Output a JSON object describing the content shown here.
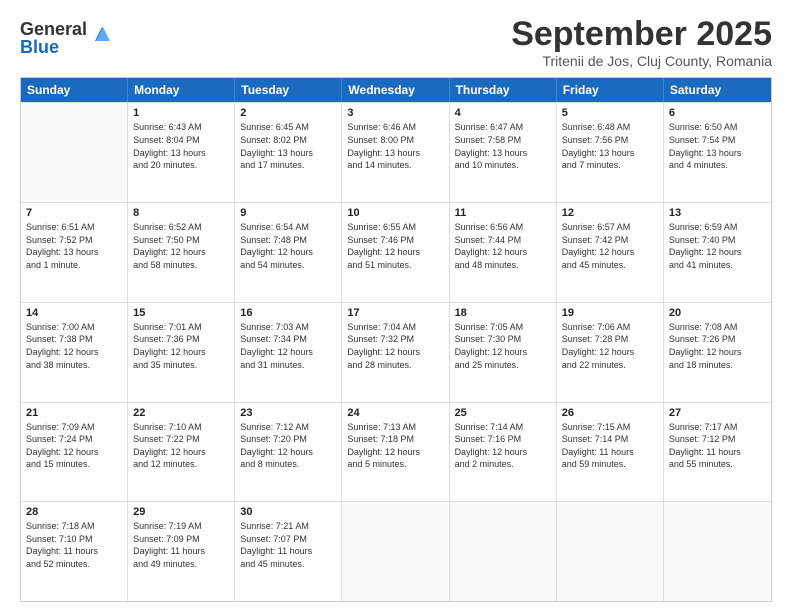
{
  "logo": {
    "general": "General",
    "blue": "Blue"
  },
  "title": "September 2025",
  "subtitle": "Tritenii de Jos, Cluj County, Romania",
  "header_days": [
    "Sunday",
    "Monday",
    "Tuesday",
    "Wednesday",
    "Thursday",
    "Friday",
    "Saturday"
  ],
  "weeks": [
    [
      {
        "day": "",
        "empty": true,
        "lines": []
      },
      {
        "day": "1",
        "empty": false,
        "lines": [
          "Sunrise: 6:43 AM",
          "Sunset: 8:04 PM",
          "Daylight: 13 hours",
          "and 20 minutes."
        ]
      },
      {
        "day": "2",
        "empty": false,
        "lines": [
          "Sunrise: 6:45 AM",
          "Sunset: 8:02 PM",
          "Daylight: 13 hours",
          "and 17 minutes."
        ]
      },
      {
        "day": "3",
        "empty": false,
        "lines": [
          "Sunrise: 6:46 AM",
          "Sunset: 8:00 PM",
          "Daylight: 13 hours",
          "and 14 minutes."
        ]
      },
      {
        "day": "4",
        "empty": false,
        "lines": [
          "Sunrise: 6:47 AM",
          "Sunset: 7:58 PM",
          "Daylight: 13 hours",
          "and 10 minutes."
        ]
      },
      {
        "day": "5",
        "empty": false,
        "lines": [
          "Sunrise: 6:48 AM",
          "Sunset: 7:56 PM",
          "Daylight: 13 hours",
          "and 7 minutes."
        ]
      },
      {
        "day": "6",
        "empty": false,
        "lines": [
          "Sunrise: 6:50 AM",
          "Sunset: 7:54 PM",
          "Daylight: 13 hours",
          "and 4 minutes."
        ]
      }
    ],
    [
      {
        "day": "7",
        "empty": false,
        "lines": [
          "Sunrise: 6:51 AM",
          "Sunset: 7:52 PM",
          "Daylight: 13 hours",
          "and 1 minute."
        ]
      },
      {
        "day": "8",
        "empty": false,
        "lines": [
          "Sunrise: 6:52 AM",
          "Sunset: 7:50 PM",
          "Daylight: 12 hours",
          "and 58 minutes."
        ]
      },
      {
        "day": "9",
        "empty": false,
        "lines": [
          "Sunrise: 6:54 AM",
          "Sunset: 7:48 PM",
          "Daylight: 12 hours",
          "and 54 minutes."
        ]
      },
      {
        "day": "10",
        "empty": false,
        "lines": [
          "Sunrise: 6:55 AM",
          "Sunset: 7:46 PM",
          "Daylight: 12 hours",
          "and 51 minutes."
        ]
      },
      {
        "day": "11",
        "empty": false,
        "lines": [
          "Sunrise: 6:56 AM",
          "Sunset: 7:44 PM",
          "Daylight: 12 hours",
          "and 48 minutes."
        ]
      },
      {
        "day": "12",
        "empty": false,
        "lines": [
          "Sunrise: 6:57 AM",
          "Sunset: 7:42 PM",
          "Daylight: 12 hours",
          "and 45 minutes."
        ]
      },
      {
        "day": "13",
        "empty": false,
        "lines": [
          "Sunrise: 6:59 AM",
          "Sunset: 7:40 PM",
          "Daylight: 12 hours",
          "and 41 minutes."
        ]
      }
    ],
    [
      {
        "day": "14",
        "empty": false,
        "lines": [
          "Sunrise: 7:00 AM",
          "Sunset: 7:38 PM",
          "Daylight: 12 hours",
          "and 38 minutes."
        ]
      },
      {
        "day": "15",
        "empty": false,
        "lines": [
          "Sunrise: 7:01 AM",
          "Sunset: 7:36 PM",
          "Daylight: 12 hours",
          "and 35 minutes."
        ]
      },
      {
        "day": "16",
        "empty": false,
        "lines": [
          "Sunrise: 7:03 AM",
          "Sunset: 7:34 PM",
          "Daylight: 12 hours",
          "and 31 minutes."
        ]
      },
      {
        "day": "17",
        "empty": false,
        "lines": [
          "Sunrise: 7:04 AM",
          "Sunset: 7:32 PM",
          "Daylight: 12 hours",
          "and 28 minutes."
        ]
      },
      {
        "day": "18",
        "empty": false,
        "lines": [
          "Sunrise: 7:05 AM",
          "Sunset: 7:30 PM",
          "Daylight: 12 hours",
          "and 25 minutes."
        ]
      },
      {
        "day": "19",
        "empty": false,
        "lines": [
          "Sunrise: 7:06 AM",
          "Sunset: 7:28 PM",
          "Daylight: 12 hours",
          "and 22 minutes."
        ]
      },
      {
        "day": "20",
        "empty": false,
        "lines": [
          "Sunrise: 7:08 AM",
          "Sunset: 7:26 PM",
          "Daylight: 12 hours",
          "and 18 minutes."
        ]
      }
    ],
    [
      {
        "day": "21",
        "empty": false,
        "lines": [
          "Sunrise: 7:09 AM",
          "Sunset: 7:24 PM",
          "Daylight: 12 hours",
          "and 15 minutes."
        ]
      },
      {
        "day": "22",
        "empty": false,
        "lines": [
          "Sunrise: 7:10 AM",
          "Sunset: 7:22 PM",
          "Daylight: 12 hours",
          "and 12 minutes."
        ]
      },
      {
        "day": "23",
        "empty": false,
        "lines": [
          "Sunrise: 7:12 AM",
          "Sunset: 7:20 PM",
          "Daylight: 12 hours",
          "and 8 minutes."
        ]
      },
      {
        "day": "24",
        "empty": false,
        "lines": [
          "Sunrise: 7:13 AM",
          "Sunset: 7:18 PM",
          "Daylight: 12 hours",
          "and 5 minutes."
        ]
      },
      {
        "day": "25",
        "empty": false,
        "lines": [
          "Sunrise: 7:14 AM",
          "Sunset: 7:16 PM",
          "Daylight: 12 hours",
          "and 2 minutes."
        ]
      },
      {
        "day": "26",
        "empty": false,
        "lines": [
          "Sunrise: 7:15 AM",
          "Sunset: 7:14 PM",
          "Daylight: 11 hours",
          "and 59 minutes."
        ]
      },
      {
        "day": "27",
        "empty": false,
        "lines": [
          "Sunrise: 7:17 AM",
          "Sunset: 7:12 PM",
          "Daylight: 11 hours",
          "and 55 minutes."
        ]
      }
    ],
    [
      {
        "day": "28",
        "empty": false,
        "lines": [
          "Sunrise: 7:18 AM",
          "Sunset: 7:10 PM",
          "Daylight: 11 hours",
          "and 52 minutes."
        ]
      },
      {
        "day": "29",
        "empty": false,
        "lines": [
          "Sunrise: 7:19 AM",
          "Sunset: 7:09 PM",
          "Daylight: 11 hours",
          "and 49 minutes."
        ]
      },
      {
        "day": "30",
        "empty": false,
        "lines": [
          "Sunrise: 7:21 AM",
          "Sunset: 7:07 PM",
          "Daylight: 11 hours",
          "and 45 minutes."
        ]
      },
      {
        "day": "",
        "empty": true,
        "lines": []
      },
      {
        "day": "",
        "empty": true,
        "lines": []
      },
      {
        "day": "",
        "empty": true,
        "lines": []
      },
      {
        "day": "",
        "empty": true,
        "lines": []
      }
    ]
  ]
}
